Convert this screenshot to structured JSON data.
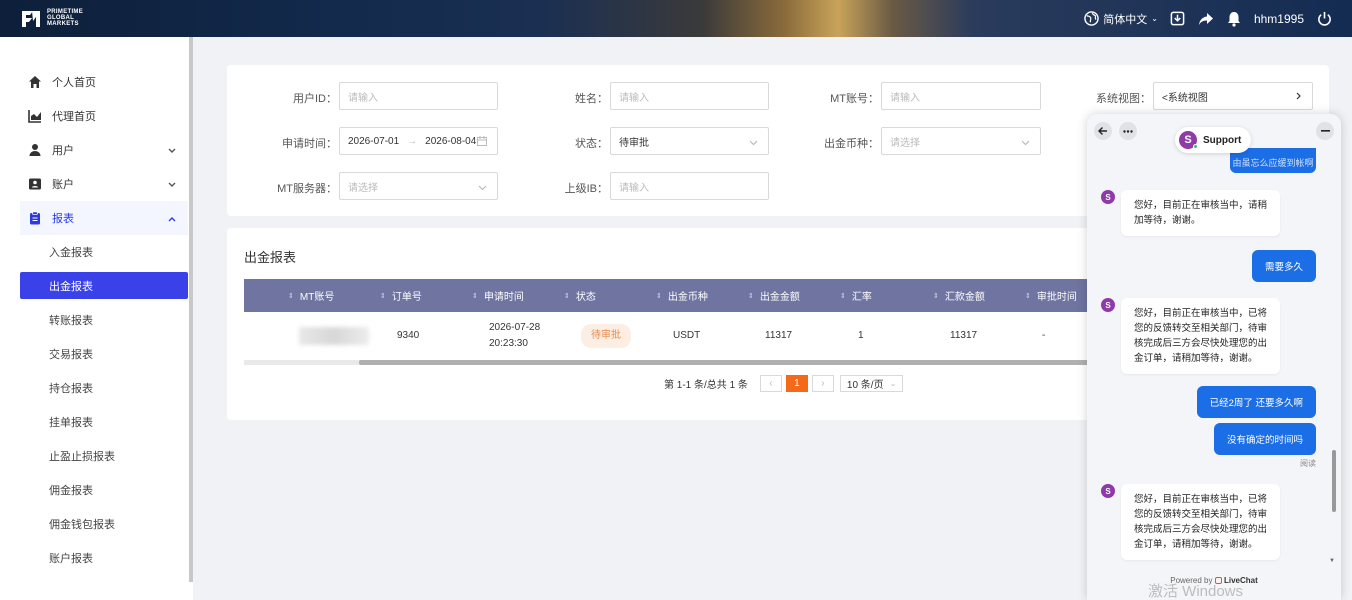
{
  "header": {
    "logo_text": [
      "PRIMETIME",
      "GLOBAL",
      "MARKETS"
    ],
    "language": "简体中文",
    "username": "hhm1995"
  },
  "sidebar": {
    "items": [
      {
        "label": "个人首页",
        "icon": "home-icon"
      },
      {
        "label": "代理首页",
        "icon": "chart-icon"
      },
      {
        "label": "用户",
        "icon": "user-icon"
      },
      {
        "label": "账户",
        "icon": "account-card-icon"
      },
      {
        "label": "报表",
        "icon": "report-clipboard-icon"
      }
    ],
    "report_subitems": [
      "入金报表",
      "出金报表",
      "转账报表",
      "交易报表",
      "持仓报表",
      "挂单报表",
      "止盈止损报表",
      "佣金报表",
      "佣金钱包报表",
      "账户报表"
    ]
  },
  "filters": {
    "user_id": {
      "label": "用户ID：",
      "placeholder": "请输入"
    },
    "name": {
      "label": "姓名：",
      "placeholder": "请输入"
    },
    "mt_account": {
      "label": "MT账号：",
      "placeholder": "请输入"
    },
    "system_view": {
      "label": "系统视图：",
      "value": "<系统视图"
    },
    "apply_time": {
      "label": "申请时间：",
      "start": "2026-07-01",
      "end": "2026-08-04"
    },
    "status": {
      "label": "状态：",
      "value": "待审批"
    },
    "currency": {
      "label": "出金币种：",
      "placeholder": "请选择"
    },
    "mt_server": {
      "label": "MT服务器：",
      "placeholder": "请选择"
    },
    "superior_ib": {
      "label": "上级IB：",
      "placeholder": "请输入"
    }
  },
  "table": {
    "title": "出金报表",
    "columns": [
      "MT账号",
      "订单号",
      "申请时间",
      "状态",
      "出金币种",
      "出金金额",
      "汇率",
      "汇款金额",
      "审批时间"
    ],
    "rows": [
      {
        "order_no": "9340",
        "apply_time_date": "2026-07-28",
        "apply_time_clock": "20:23:30",
        "status": "待审批",
        "currency": "USDT",
        "amount": "11317",
        "rate": "1",
        "remit_amount": "11317",
        "approve_time": "-"
      }
    ]
  },
  "pagination": {
    "total_text": "第 1-1 条/总共 1 条",
    "current_page": "1",
    "page_size": "10 条/页"
  },
  "chat": {
    "title": "Support",
    "avatar_letter": "S",
    "partial_message": "由虽忘么应缓到帐啊",
    "messages": [
      {
        "from": "agent",
        "lines": [
          "您好，目前正在审核当中，请稍",
          "加等待，谢谢。"
        ]
      },
      {
        "from": "user",
        "text": "需要多久"
      },
      {
        "from": "agent",
        "lines": [
          "您好，目前正在审核当中，已将",
          "您的反馈转交至相关部门，待审",
          "核完成后三方会尽快处理您的出",
          "金订单，请稍加等待，谢谢。"
        ]
      },
      {
        "from": "user",
        "text": "已经2周了 还要多久啊"
      },
      {
        "from": "user",
        "text": "没有确定的时间吗"
      },
      {
        "from": "agent",
        "lines": [
          "您好，目前正在审核当中，已将",
          "您的反馈转交至相关部门，待审",
          "核完成后三方会尽快处理您的出",
          "金订单，请稍加等待，谢谢。"
        ]
      }
    ],
    "read_label": "阅读",
    "powered_by": "Powered by",
    "powered_brand": "LiveChat"
  },
  "watermark": "激活 Windows",
  "colors": {
    "accent": "#3a41e8",
    "table_header": "#6f74a0",
    "page_active": "#f46a1a",
    "chat_user_bubble": "#1b6ee6",
    "chat_avatar": "#8e3aa7"
  }
}
